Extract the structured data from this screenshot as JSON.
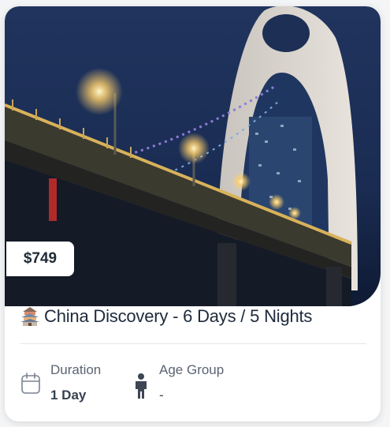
{
  "card": {
    "price": "$749",
    "title": "China Discovery - 6 Days / 5  Nights",
    "title_icon": "pagoda-icon",
    "duration": {
      "label": "Duration",
      "value": "1 Day",
      "icon": "calendar-icon"
    },
    "age_group": {
      "label": "Age Group",
      "value": "-",
      "icon": "person-icon"
    }
  },
  "colors": {
    "title_text": "#1e2a3c",
    "label_text": "#5b6472",
    "sky": "#1b2d55",
    "bridge_lights": "#ffd27a"
  }
}
